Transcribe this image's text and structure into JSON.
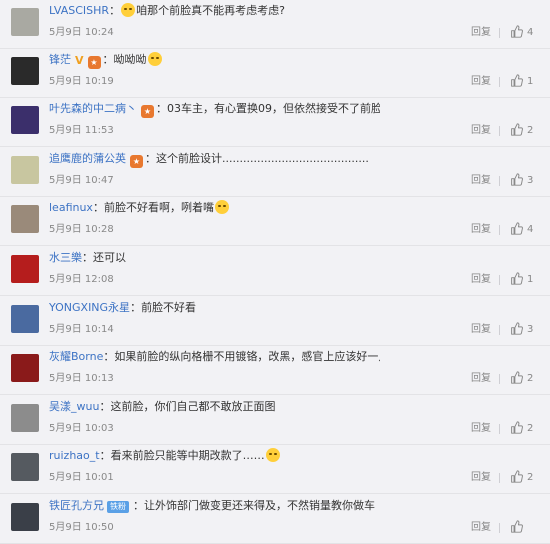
{
  "comments": [
    {
      "user": "LVASCISHR",
      "text": "咱那个前脸真不能再考虑考虑?",
      "time": "5月9日 10:24",
      "reply": "回复",
      "likes": "4",
      "avatar_color": "#a9a9a2",
      "emoji_before_text": true
    },
    {
      "user": "锋茫",
      "text": "呦呦呦",
      "time": "5月9日 10:19",
      "reply": "回复",
      "likes": "1",
      "avatar_color": "#2a2a2a",
      "vip": "V"
    },
    {
      "user": "叶先森的中二病丶",
      "text": "03车主，有心置换09，但依然接受不了前脸",
      "time": "5月9日 11:53",
      "reply": "回复",
      "likes": "2",
      "avatar_color": "#3b2f6b"
    },
    {
      "user": "追鹰鹿的蒲公英",
      "text": "这个前脸设计..........................................",
      "time": "5月9日 10:47",
      "reply": "回复",
      "likes": "3",
      "avatar_color": "#c8c6a0"
    },
    {
      "user": "leafinux",
      "text": "前脸不好看啊，咧着嘴",
      "time": "5月9日 10:28",
      "reply": "回复",
      "likes": "4",
      "avatar_color": "#9a8a7a"
    },
    {
      "user": "水三樂",
      "text": "还可以",
      "time": "5月9日 12:08",
      "reply": "回复",
      "likes": "1",
      "avatar_color": "#b51d1d"
    },
    {
      "user": "YONGXING永星",
      "text": "前脸不好看",
      "time": "5月9日 10:14",
      "reply": "回复",
      "likes": "3",
      "avatar_color": "#4a6aa0"
    },
    {
      "user": "灰耀Borne",
      "text": "如果前脸的纵向格栅不用镀铬，改黑，感官上应该好一点",
      "time": "5月9日 10:13",
      "reply": "回复",
      "likes": "2",
      "avatar_color": "#8a1a1a"
    },
    {
      "user": "吴漾_wuu",
      "text": "这前脸，你们自己都不敢放正面图",
      "time": "5月9日 10:03",
      "reply": "回复",
      "likes": "2",
      "avatar_color": "#8c8c8c"
    },
    {
      "user": "ruizhao_t",
      "text": "看来前脸只能等中期改款了……",
      "time": "5月9日 10:01",
      "reply": "回复",
      "likes": "2",
      "avatar_color": "#555a60"
    },
    {
      "user": "铁匠孔方兄",
      "text": "让外饰部门做变更还来得及，不然销量教你做车",
      "time": "5月9日 10:50",
      "reply": "回复",
      "likes": "",
      "avatar_color": "#3a3f48",
      "tag": "铁粉"
    }
  ]
}
